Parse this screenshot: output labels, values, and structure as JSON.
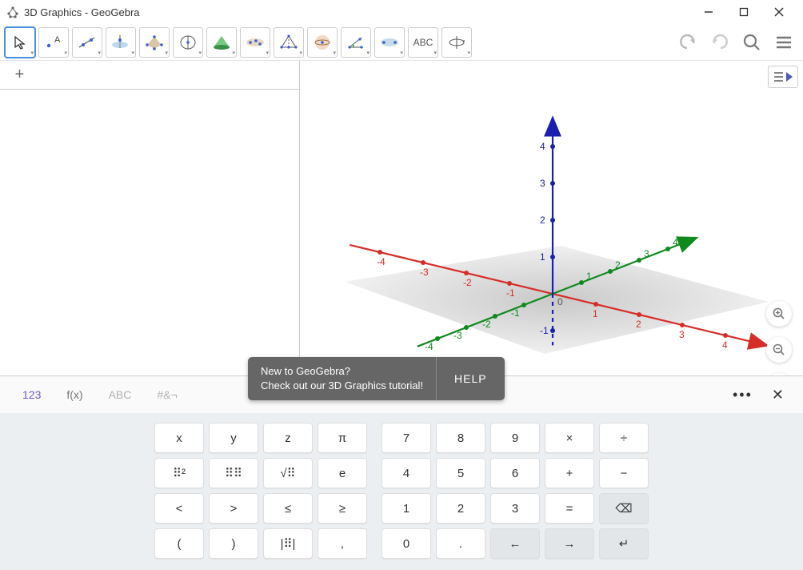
{
  "title": "3D Graphics - GeoGebra",
  "toolbar": {
    "tools": [
      {
        "name": "move-tool",
        "selected": true
      },
      {
        "name": "point-tool"
      },
      {
        "name": "line-tool"
      },
      {
        "name": "perpendicular-tool"
      },
      {
        "name": "polygon-tool"
      },
      {
        "name": "circle-tool"
      },
      {
        "name": "intersect-tool"
      },
      {
        "name": "plane-tool"
      },
      {
        "name": "pyramid-tool"
      },
      {
        "name": "sphere-tool"
      },
      {
        "name": "angle-tool"
      },
      {
        "name": "reflect-tool"
      },
      {
        "name": "text-tool",
        "label": "ABC"
      },
      {
        "name": "rotate-view-tool"
      }
    ]
  },
  "input_modes": {
    "numeric": "123",
    "function": "f(x)",
    "alpha": "ABC",
    "symbol": "#&¬"
  },
  "tooltip": {
    "line1": "New to GeoGebra?",
    "line2": "Check out our 3D Graphics tutorial!",
    "button": "HELP"
  },
  "view": {
    "zoom_in": "+",
    "zoom_out": "−",
    "fullscreen": "⛶"
  },
  "axis": {
    "x": {
      "ticks": [
        -4,
        -3,
        -2,
        -1,
        1,
        2,
        3,
        4
      ],
      "color": "#d62d28"
    },
    "y": {
      "ticks": [
        -4,
        -3,
        -2,
        -1,
        1,
        2,
        3,
        4
      ],
      "color": "#108a1f"
    },
    "z": {
      "ticks": [
        -1,
        1,
        2,
        3,
        4
      ],
      "zero": "0",
      "color": "#1a1fb0"
    }
  },
  "keypad": {
    "left": [
      [
        "x",
        "y",
        "z",
        "π"
      ],
      [
        "⠿²",
        "⠿⠿",
        "√⠿",
        "e"
      ],
      [
        "<",
        ">",
        "≤",
        "≥"
      ],
      [
        "(",
        ")",
        "|⠿|",
        ","
      ]
    ],
    "right": [
      [
        "7",
        "8",
        "9",
        "×",
        "÷"
      ],
      [
        "4",
        "5",
        "6",
        "+",
        "−"
      ],
      [
        "1",
        "2",
        "3",
        "=",
        "⌫"
      ],
      [
        "0",
        ".",
        "←",
        "→",
        "↵"
      ]
    ]
  }
}
